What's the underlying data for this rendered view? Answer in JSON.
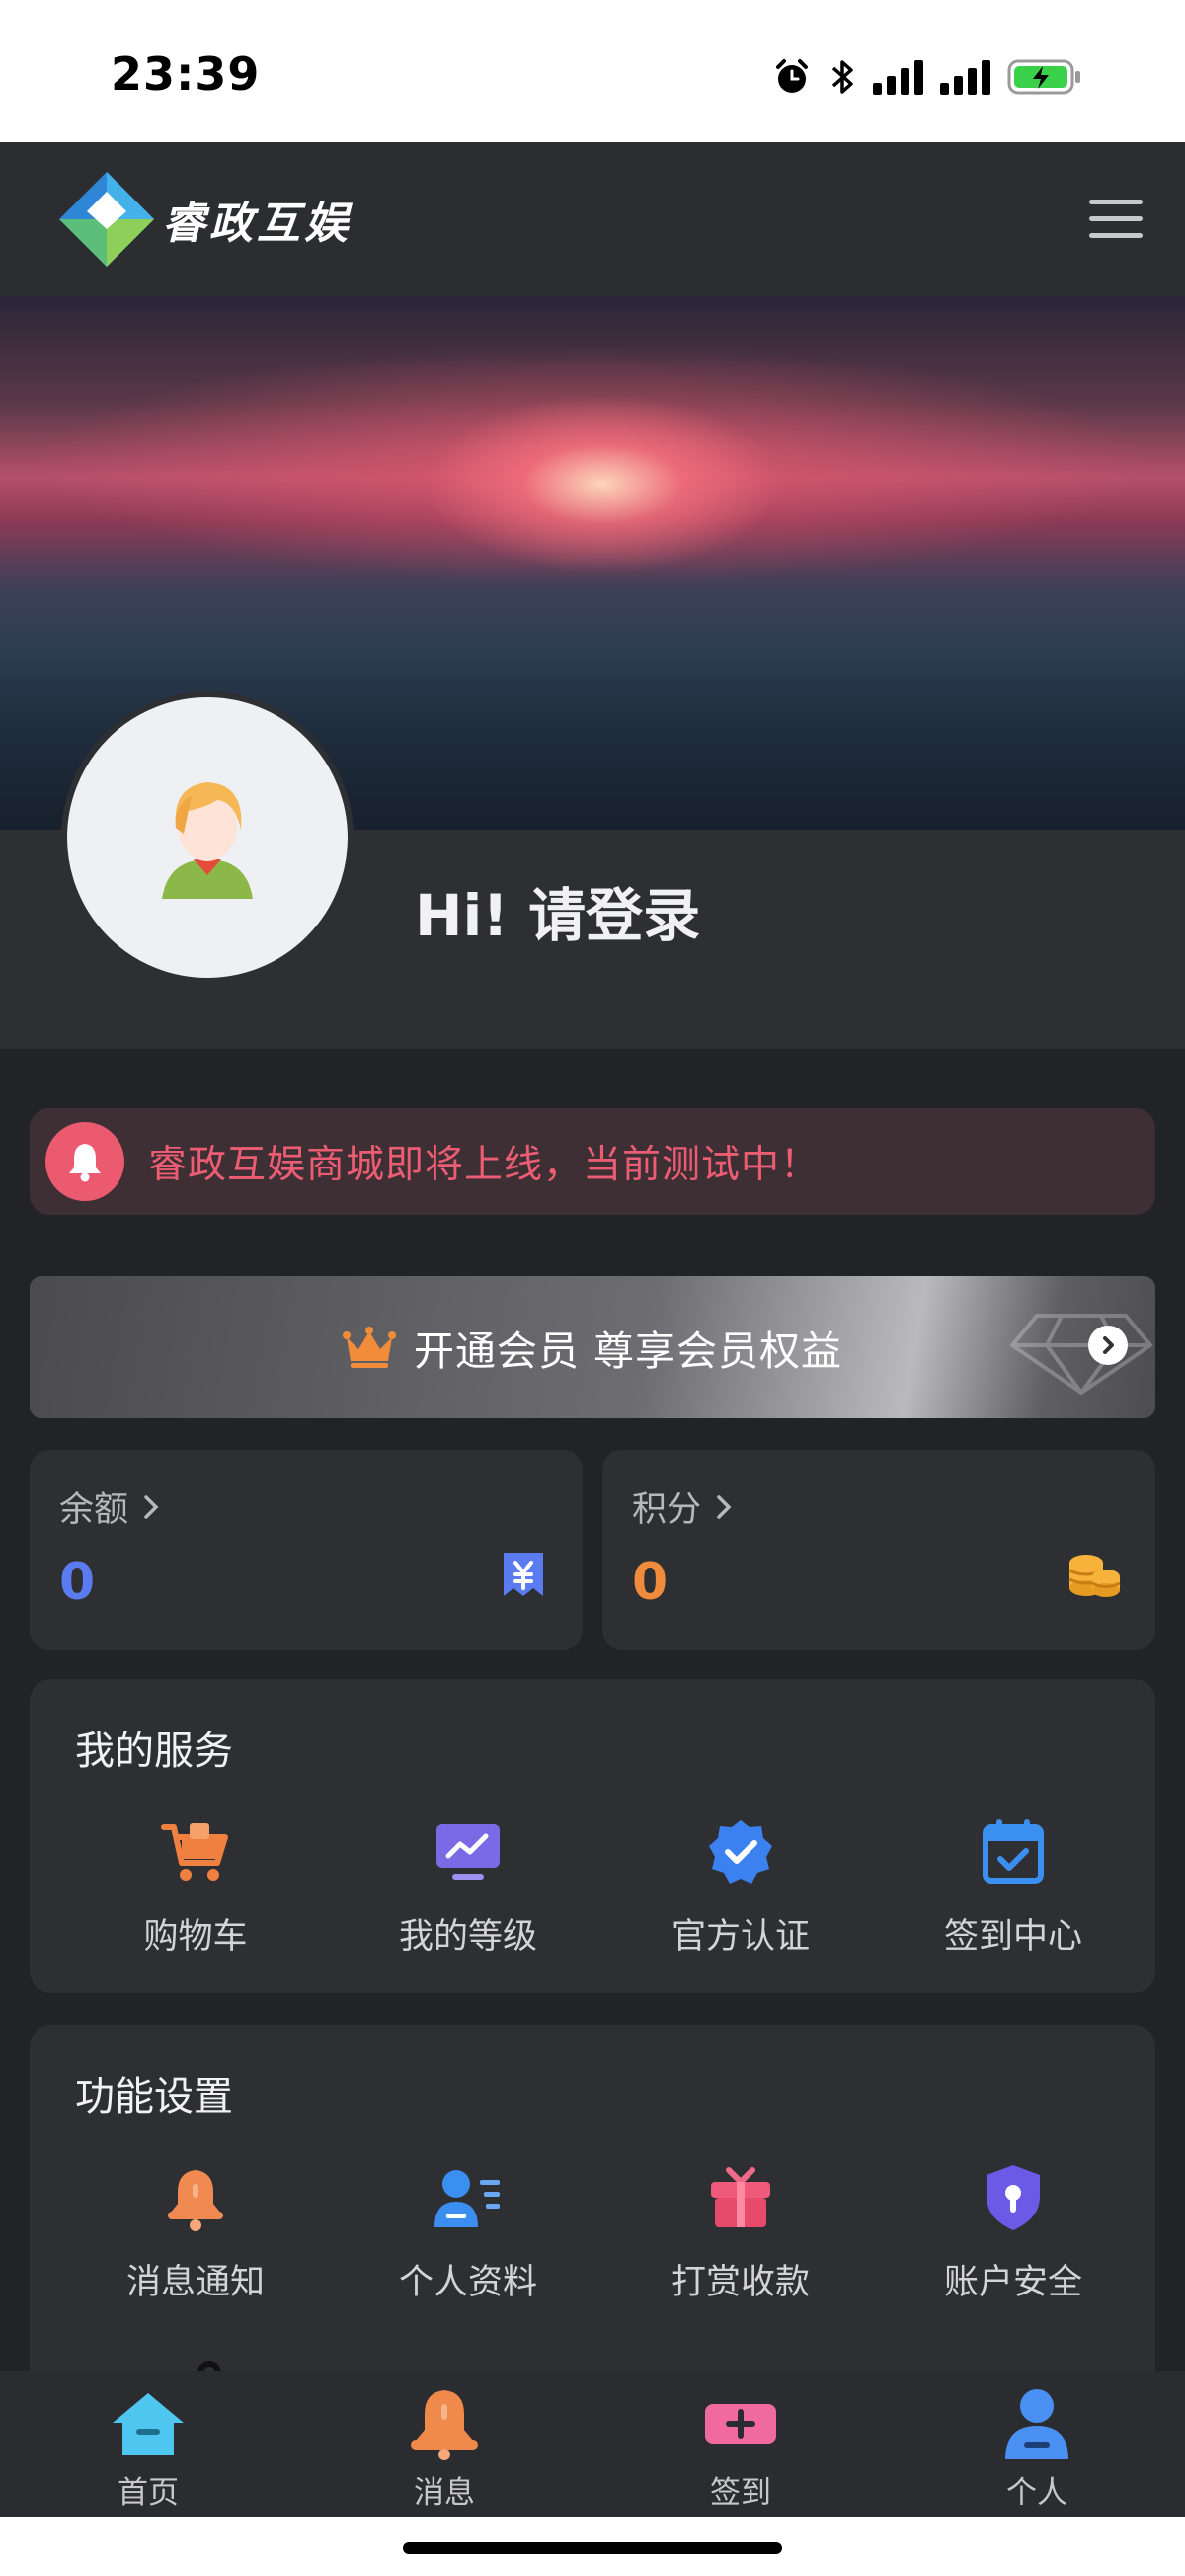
{
  "status_bar": {
    "time": "23:39",
    "icons": [
      "alarm-icon",
      "bluetooth-icon",
      "signal-icon",
      "signal-icon",
      "battery-charging-icon"
    ]
  },
  "header": {
    "logo_text": "睿政互娱",
    "menu_icon": "hamburger-menu-icon"
  },
  "profile": {
    "greeting": "Hi! 请登录"
  },
  "notice": {
    "text": "睿政互娱商城即将上线，当前测试中！",
    "color": "#ec5d74"
  },
  "vip": {
    "text": "开通会员 尊享会员权益"
  },
  "stats": {
    "balance": {
      "label": "余额",
      "value": "0",
      "color": "#5b7cf0"
    },
    "points": {
      "label": "积分",
      "value": "0",
      "color": "#f08a3c"
    }
  },
  "services": {
    "title": "我的服务",
    "items": [
      {
        "label": "购物车",
        "icon": "shopping-cart-icon"
      },
      {
        "label": "我的等级",
        "icon": "level-monitor-icon"
      },
      {
        "label": "官方认证",
        "icon": "verified-badge-icon"
      },
      {
        "label": "签到中心",
        "icon": "calendar-check-icon"
      }
    ]
  },
  "settings": {
    "title": "功能设置",
    "items": [
      {
        "label": "消息通知",
        "icon": "bell-icon"
      },
      {
        "label": "个人资料",
        "icon": "profile-card-icon"
      },
      {
        "label": "打赏收款",
        "icon": "gift-icon"
      },
      {
        "label": "账户安全",
        "icon": "shield-lock-icon"
      }
    ]
  },
  "tabbar": {
    "items": [
      {
        "label": "首页",
        "icon": "home-icon"
      },
      {
        "label": "消息",
        "icon": "bell-icon"
      },
      {
        "label": "签到",
        "icon": "checkin-ticket-icon"
      },
      {
        "label": "个人",
        "icon": "user-icon"
      }
    ]
  }
}
